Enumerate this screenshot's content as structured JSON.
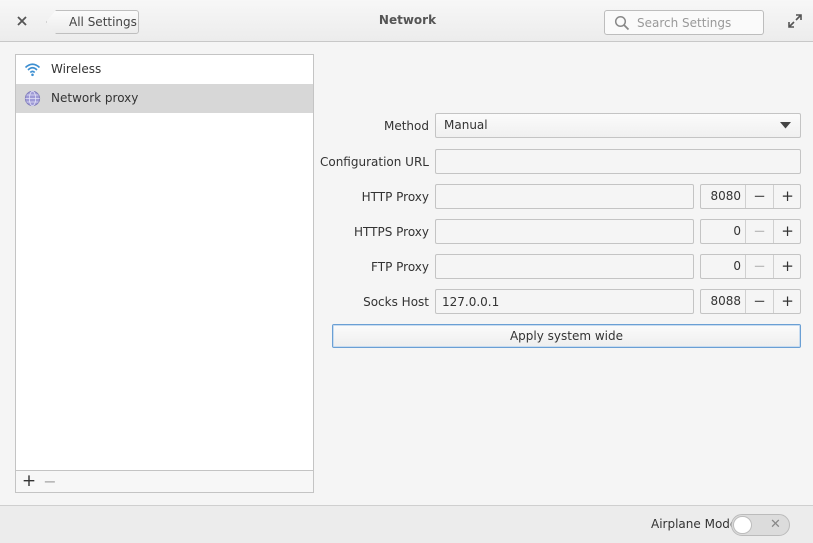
{
  "header": {
    "back_label": "All Settings",
    "title": "Network",
    "search_placeholder": "Search Settings"
  },
  "sidebar": {
    "items": [
      {
        "label": "Wireless",
        "icon": "wifi-icon",
        "selected": false
      },
      {
        "label": "Network proxy",
        "icon": "globe-icon",
        "selected": true
      }
    ],
    "add_label": "+",
    "remove_label": "−"
  },
  "form": {
    "method": {
      "label": "Method",
      "value": "Manual"
    },
    "config_url": {
      "label": "Configuration URL",
      "value": ""
    },
    "http": {
      "label": "HTTP Proxy",
      "value": "",
      "port": "8080"
    },
    "https": {
      "label": "HTTPS Proxy",
      "value": "",
      "port": "0"
    },
    "ftp": {
      "label": "FTP Proxy",
      "value": "",
      "port": "0"
    },
    "socks": {
      "label": "Socks Host",
      "value": "127.0.0.1",
      "port": "8088"
    },
    "apply_label": "Apply system wide",
    "minus_glyph": "−",
    "plus_glyph": "+"
  },
  "footer": {
    "airplane_label": "Airplane Mode",
    "airplane_on": false
  },
  "colors": {
    "accent": "#6a9fd4",
    "selection": "#d7d7d7",
    "wifi": "#3d8fd1"
  }
}
